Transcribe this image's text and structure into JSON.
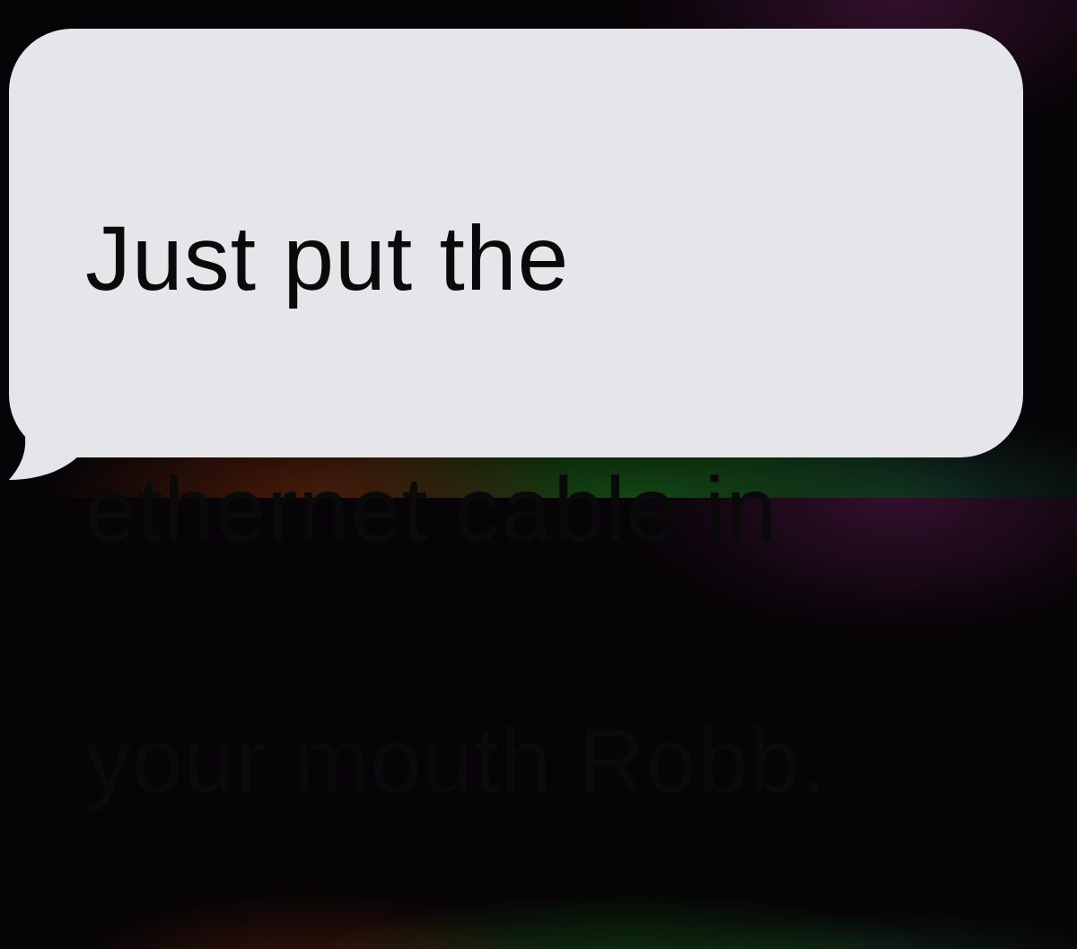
{
  "message": {
    "lines": [
      "Just put the",
      "ethernet cable in",
      "your mouth Robb."
    ],
    "bubble_color": "#e6e5ea",
    "text_color": "#0a0a0a"
  }
}
